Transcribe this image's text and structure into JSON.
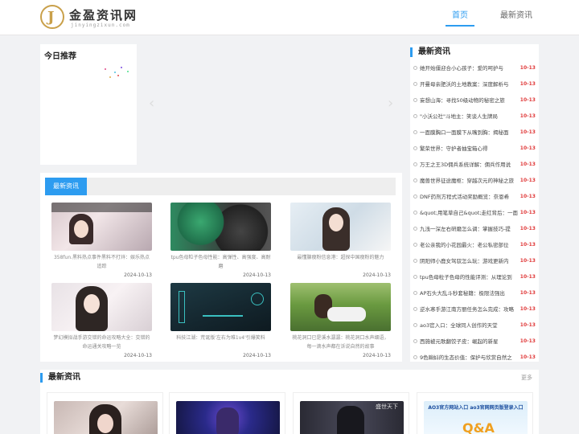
{
  "header": {
    "logo_mark": "J",
    "logo_name": "金盈资讯网",
    "logo_sub": "jinyingzixun.com",
    "nav": [
      "首页",
      "最新资讯"
    ]
  },
  "today": {
    "title": "今日推荐"
  },
  "news_panel": {
    "tab": "最新资讯",
    "cards": [
      {
        "caption": "358fun.黑料热点事件黑料不打烊：娱乐热点追踪",
        "date": "2024-10-13"
      },
      {
        "caption": "tpu色母粒子色母性能：高弹性、高强度、高耐磨",
        "date": "2024-10-13"
      },
      {
        "caption": "最懂腺瘦粉信息港：超探中国瘦粉的魅力",
        "date": "2024-10-13"
      },
      {
        "caption": "梦幻模拟战手游交错的命运攻略大全：交错的命运通关攻略一览",
        "date": "2024-10-13"
      },
      {
        "caption": "科技江湖：荒诞版'左右为难1v4'引爆笑料",
        "date": "2024-10-13"
      },
      {
        "caption": "桃花洞口已是溪水潺潺：桃花洞口水声细语，每一滴水声都在诉说自然的故事",
        "date": "2024-10-13"
      }
    ]
  },
  "sidebar": {
    "title": "最新资讯",
    "items": [
      {
        "title": "她开始僵迎合小心孩子：爱的呵护与",
        "date": "10-13"
      },
      {
        "title": "开曼母亲肥沃的土地教案：深度解析与",
        "date": "10-13"
      },
      {
        "title": "妄想山海：寻找50级动物的秘密之旅",
        "date": "10-13"
      },
      {
        "title": "\"小沃公社\"斗地主：笑谈人生牌局",
        "date": "10-13"
      },
      {
        "title": "一面膜胸口一面膜下从嘴到胸：揭秘面",
        "date": "10-13"
      },
      {
        "title": "繁荣世界：守护者抽宝箱心得",
        "date": "10-13"
      },
      {
        "title": "万王之王3D佣兵系统详解：佣兵作用说",
        "date": "10-13"
      },
      {
        "title": "魔兽世界征途魔枢：穿越次元的神秘之旅",
        "date": "10-13"
      },
      {
        "title": "DNF药剂方程式活动奖励概览：奈恩希",
        "date": "10-13"
      },
      {
        "title": "&quot;用笔草自己&quot;走红背后：一面",
        "date": "10-13"
      },
      {
        "title": "九浅一深左右研磨怎么调：掌握技巧-提",
        "date": "10-13"
      },
      {
        "title": "老公亲我的小花园最火：老公私密部位",
        "date": "10-13"
      },
      {
        "title": "阴阳师小鹿女驾驭怎么玩：游戏更新内",
        "date": "10-13"
      },
      {
        "title": "tpu色母粒子色母的性能评测：从理论到",
        "date": "10-13"
      },
      {
        "title": "AP石头大乱斗秒套秘籍：极限法强出",
        "date": "10-13"
      },
      {
        "title": "逆水寒手游江南方丽任务怎么完成：攻略",
        "date": "10-13"
      },
      {
        "title": "ao3官入口：全球同人创作的天堂",
        "date": "10-13"
      },
      {
        "title": "西施被元歌翻饺子皮：崛起的新星",
        "date": "10-13"
      },
      {
        "title": "9色蝌蚪的生态价值：保护与欣赏自然之",
        "date": "10-13"
      }
    ]
  },
  "bottom": {
    "title": "最新资讯",
    "more": "更多",
    "card4_text": "AO3官方网站入口 ao3官网网页版登录入口",
    "card4_logo": "Q&A",
    "card3_logo": "盛世天下"
  },
  "colors": {
    "accent": "#2d9cf0",
    "date_red": "#e03a3a",
    "logo_gold": "#c9a04a"
  }
}
